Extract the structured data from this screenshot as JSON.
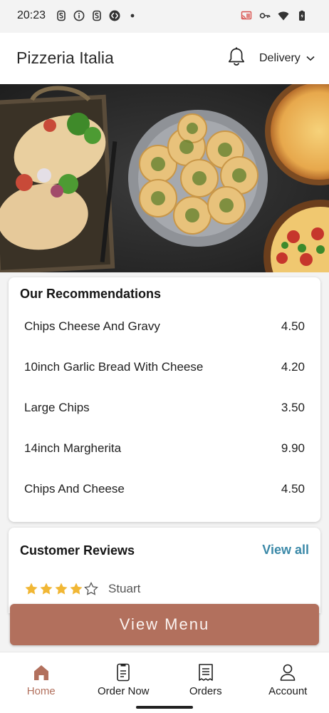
{
  "status_bar": {
    "time": "20:23",
    "left_icons": [
      "s-app-icon",
      "info-icon",
      "s-app-icon",
      "shazam-icon",
      "dot-icon"
    ],
    "right_icons": [
      "cast-icon",
      "key-icon",
      "wifi-icon",
      "battery-charging-icon"
    ]
  },
  "header": {
    "title": "Pizzeria Italia",
    "notification_icon": "bell-icon",
    "delivery_label": "Delivery",
    "delivery_icon": "chevron-down-icon"
  },
  "recommendations": {
    "title": "Our Recommendations",
    "items": [
      {
        "name": "Chips Cheese And Gravy",
        "price": "4.50"
      },
      {
        "name": "10inch Garlic Bread With Cheese",
        "price": "4.20"
      },
      {
        "name": "Large Chips",
        "price": "3.50"
      },
      {
        "name": "14inch Margherita",
        "price": "9.90"
      },
      {
        "name": "Chips And Cheese",
        "price": "4.50"
      }
    ]
  },
  "reviews": {
    "title": "Customer Reviews",
    "view_all_label": "View all",
    "items": [
      {
        "author": "Stuart",
        "rating": 4,
        "max_rating": 5
      }
    ]
  },
  "cta": {
    "view_menu_label": "View Menu"
  },
  "bottom_nav": {
    "items": [
      {
        "label": "Home",
        "icon": "home-icon",
        "active": true
      },
      {
        "label": "Order Now",
        "icon": "order-icon",
        "active": false
      },
      {
        "label": "Orders",
        "icon": "receipt-icon",
        "active": false
      },
      {
        "label": "Account",
        "icon": "person-icon",
        "active": false
      }
    ]
  },
  "colors": {
    "accent": "#b2705d",
    "link": "#3b89a8",
    "star": "#f1b735"
  }
}
